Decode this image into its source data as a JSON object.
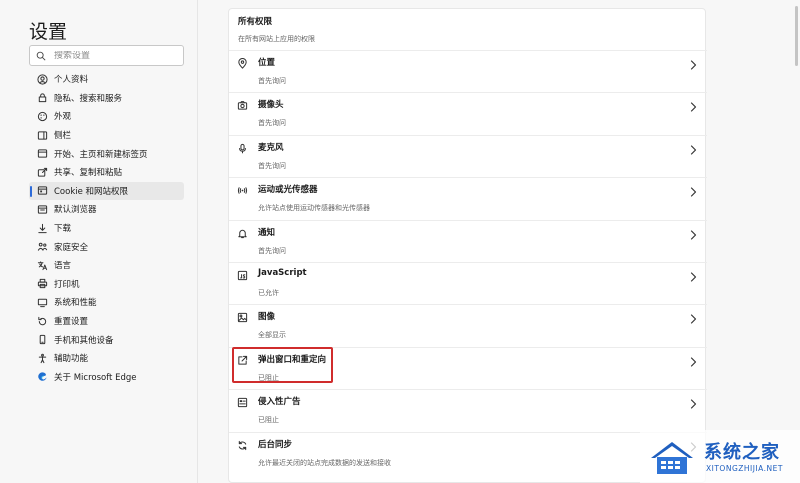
{
  "sidebar": {
    "title": "设置",
    "search_placeholder": "搜索设置",
    "items": [
      {
        "label": "个人资料",
        "icon": "profile-icon"
      },
      {
        "label": "隐私、搜索和服务",
        "icon": "privacy-lock-icon"
      },
      {
        "label": "外观",
        "icon": "appearance-icon"
      },
      {
        "label": "侧栏",
        "icon": "sidebar-icon"
      },
      {
        "label": "开始、主页和新建标签页",
        "icon": "home-icon"
      },
      {
        "label": "共享、复制和粘贴",
        "icon": "share-icon"
      },
      {
        "label": "Cookie 和网站权限",
        "icon": "cookie-icon",
        "active": true
      },
      {
        "label": "默认浏览器",
        "icon": "browser-icon"
      },
      {
        "label": "下载",
        "icon": "download-icon"
      },
      {
        "label": "家庭安全",
        "icon": "family-icon"
      },
      {
        "label": "语言",
        "icon": "language-icon"
      },
      {
        "label": "打印机",
        "icon": "printer-icon"
      },
      {
        "label": "系统和性能",
        "icon": "system-icon"
      },
      {
        "label": "重置设置",
        "icon": "reset-icon"
      },
      {
        "label": "手机和其他设备",
        "icon": "phone-icon"
      },
      {
        "label": "辅助功能",
        "icon": "accessibility-icon"
      },
      {
        "label": "关于 Microsoft Edge",
        "icon": "edge-logo-icon"
      }
    ]
  },
  "panel": {
    "title": "所有权限",
    "subtitle": "在所有网站上应用的权限",
    "rows": [
      {
        "title": "位置",
        "subtitle": "首先询问",
        "icon": "location-icon"
      },
      {
        "title": "摄像头",
        "subtitle": "首先询问",
        "icon": "camera-icon"
      },
      {
        "title": "麦克风",
        "subtitle": "首先询问",
        "icon": "microphone-icon"
      },
      {
        "title": "运动或光传感器",
        "subtitle": "允许站点使用运动传感器和光传感器",
        "icon": "sensor-icon"
      },
      {
        "title": "通知",
        "subtitle": "首先询问",
        "icon": "bell-icon"
      },
      {
        "title": "JavaScript",
        "subtitle": "已允许",
        "icon": "javascript-icon"
      },
      {
        "title": "图像",
        "subtitle": "全部显示",
        "icon": "image-icon"
      },
      {
        "title": "弹出窗口和重定向",
        "subtitle": "已阻止",
        "icon": "popup-icon",
        "highlighted": true
      },
      {
        "title": "侵入性广告",
        "subtitle": "已阻止",
        "icon": "ads-icon"
      },
      {
        "title": "后台同步",
        "subtitle": "允许最近关闭的站点完成数据的发送和接收",
        "icon": "sync-icon"
      }
    ]
  },
  "watermark": {
    "title": "系统之家",
    "subtitle": "XITONGZHIJIA.NET"
  },
  "colors": {
    "accent": "#2d6bd9",
    "highlight": "#d02c2c",
    "watermark": "#1f5fbf"
  }
}
